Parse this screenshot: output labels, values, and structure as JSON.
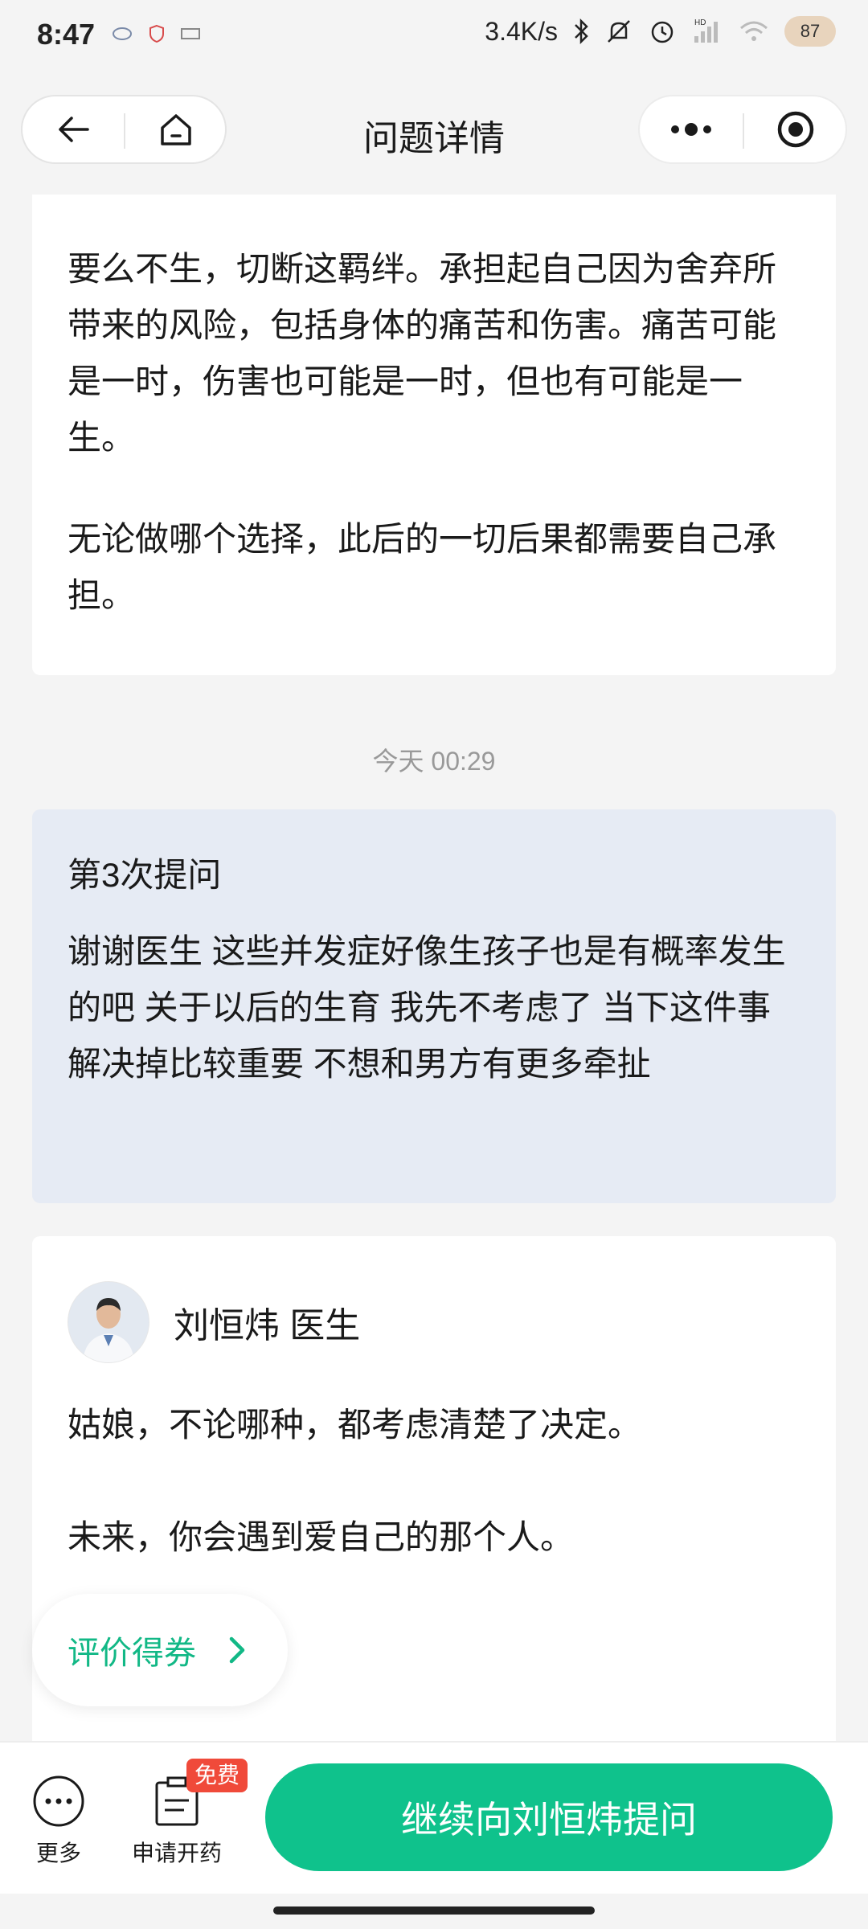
{
  "status_bar": {
    "time": "8:47",
    "network_speed": "3.4K/s",
    "battery": "87",
    "icons": [
      "notification-icon",
      "shield-icon",
      "app-icon",
      "bluetooth-icon",
      "mute-icon",
      "alarm-icon",
      "signal-icon",
      "wifi-icon",
      "battery-icon"
    ]
  },
  "header": {
    "title": "问题详情",
    "icons": [
      "back-arrow-icon",
      "home-icon",
      "more-dots-icon",
      "record-target-icon"
    ]
  },
  "answer_prev": {
    "paragraphs": [
      "要么不生，切断这羁绊。承担起自己因为舍弃所带来的风险，包括身体的痛苦和伤害。痛苦可能是一时，伤害也可能是一时，但也有可能是一生。",
      "无论做哪个选择，此后的一切后果都需要自己承担。"
    ]
  },
  "timestamp": "今天 00:29",
  "question": {
    "label": "第3次提问",
    "text": "谢谢医生 这些并发症好像生孩子也是有概率发生的吧 关于以后的生育 我先不考虑了 当下这件事解决掉比较重要 不想和男方有更多牵扯"
  },
  "answer": {
    "doctor_name": "刘恒炜 医生",
    "paragraphs": [
      "姑娘，不论哪种，都考虑清楚了决定。",
      "未来，你会遇到爱自己的那个人。"
    ]
  },
  "rate_button": {
    "label": "评价得券"
  },
  "bottom_bar": {
    "more_label": "更多",
    "prescription_label": "申请开药",
    "free_badge": "免费",
    "main_button": "继续向刘恒炜提问"
  },
  "colors": {
    "accent_green": "#0fc28c",
    "question_bg": "#e6ebf4",
    "badge_red": "#f04a3a"
  }
}
